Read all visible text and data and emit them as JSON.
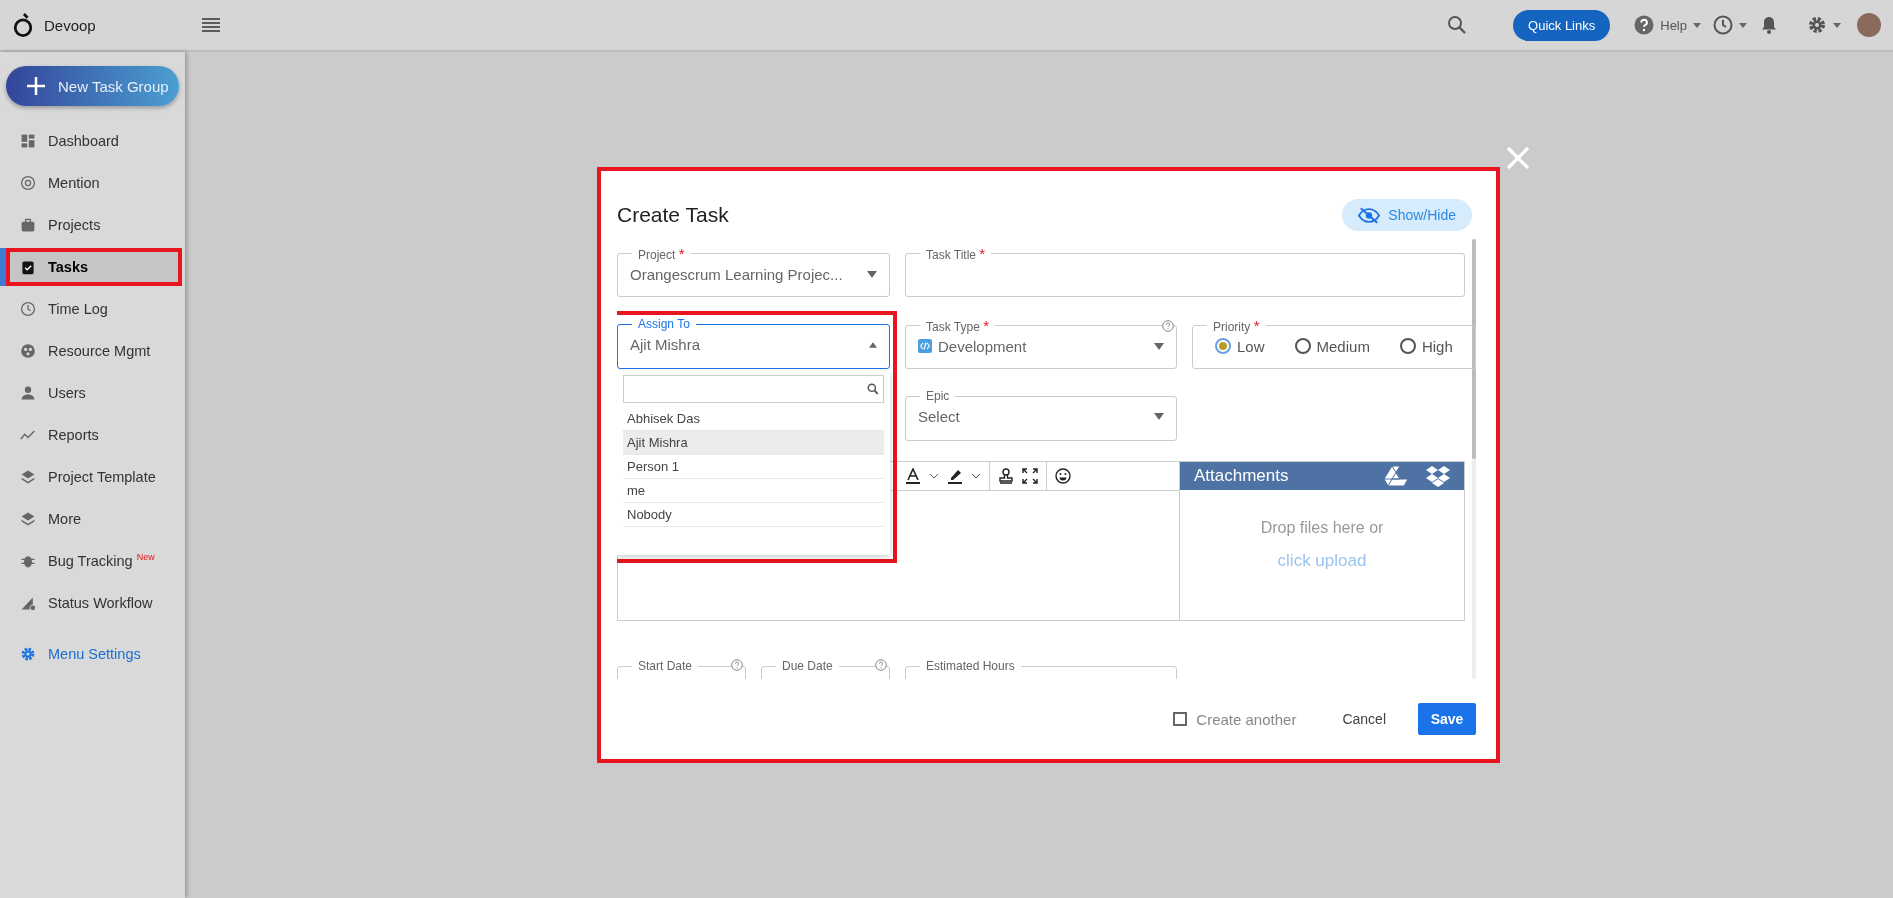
{
  "topbar": {
    "brand": "Devoop",
    "quick_links": "Quick Links",
    "help": "Help"
  },
  "sidebar": {
    "new_button": "New Task Group",
    "items": [
      {
        "label": "Dashboard",
        "selected": false
      },
      {
        "label": "Mention",
        "selected": false
      },
      {
        "label": "Projects",
        "selected": false
      },
      {
        "label": "Tasks",
        "selected": true
      },
      {
        "label": "Time Log",
        "selected": false
      },
      {
        "label": "Resource Mgmt",
        "selected": false
      },
      {
        "label": "Users",
        "selected": false
      },
      {
        "label": "Reports",
        "selected": false
      },
      {
        "label": "Project Template",
        "selected": false
      },
      {
        "label": "More",
        "selected": false
      },
      {
        "label": "Bug Tracking",
        "badge": "New",
        "selected": false
      },
      {
        "label": "Status Workflow",
        "selected": false
      }
    ],
    "menu_settings": "Menu Settings"
  },
  "dialog": {
    "title": "Create Task",
    "show_hide": "Show/Hide",
    "project": {
      "label": "Project",
      "required_mark": "*",
      "value": "Orangescrum Learning Projec..."
    },
    "task_title": {
      "label": "Task Title",
      "required_mark": "*"
    },
    "assign_to": {
      "label": "Assign To",
      "value": "Ajit Mishra",
      "expanded": true,
      "options": [
        {
          "label": "Abhisek Das",
          "selected": false
        },
        {
          "label": "Ajit Mishra",
          "selected": true
        },
        {
          "label": "Person 1",
          "selected": false
        },
        {
          "label": "me",
          "selected": false
        },
        {
          "label": "Nobody",
          "selected": false
        }
      ]
    },
    "task_type": {
      "label": "Task Type",
      "required_mark": "*",
      "value": "Development"
    },
    "priority": {
      "label": "Priority",
      "required_mark": "*",
      "options": [
        {
          "label": "Low",
          "selected": true
        },
        {
          "label": "Medium",
          "selected": false
        },
        {
          "label": "High",
          "selected": false
        }
      ]
    },
    "epic": {
      "label": "Epic",
      "value": "Select"
    },
    "attachments": {
      "title": "Attachments",
      "drop_text": "Drop files here or",
      "upload_link": "click upload"
    },
    "dates": [
      {
        "label": "Start Date"
      },
      {
        "label": "Due Date"
      }
    ],
    "estimated_hours": {
      "label": "Estimated Hours"
    },
    "create_another": {
      "label": "Create another",
      "checked": false
    },
    "cancel": "Cancel",
    "save": "Save"
  }
}
